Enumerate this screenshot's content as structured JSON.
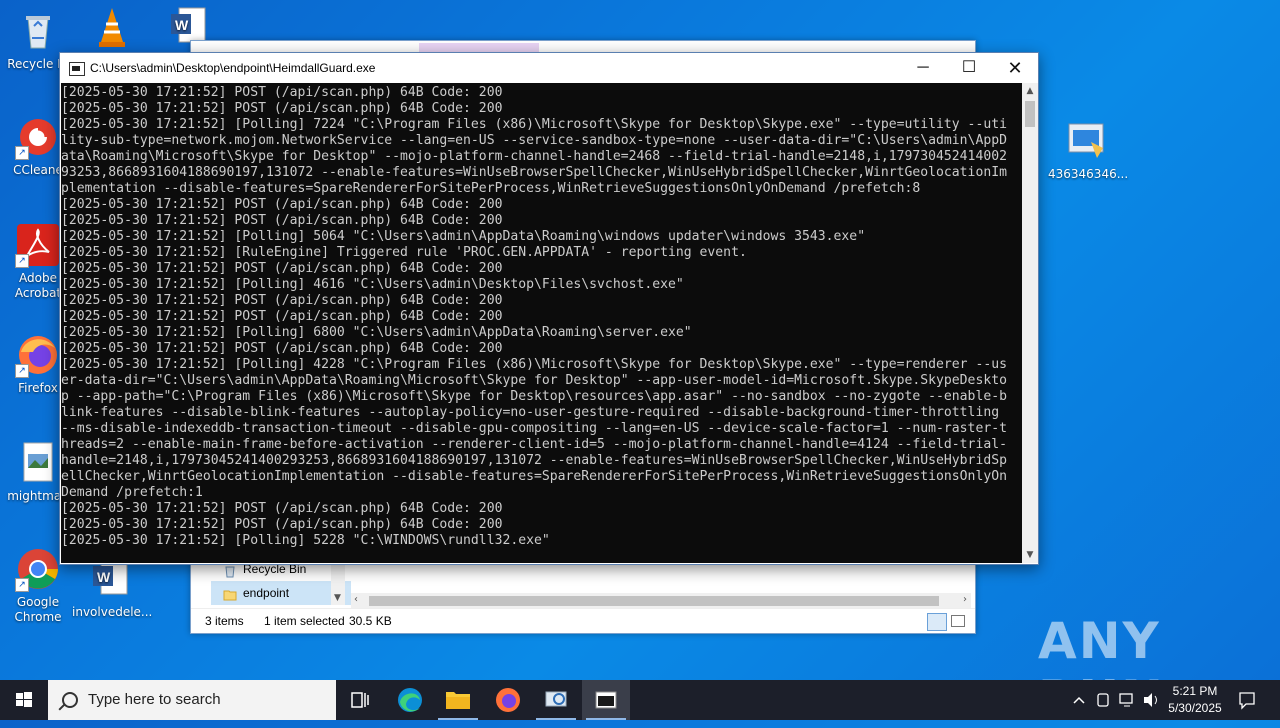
{
  "desktop": {
    "icons": [
      {
        "label": "Recycle Bi"
      },
      {
        "label": "CCleane"
      },
      {
        "label": "Adobe Acrobat"
      },
      {
        "label": "Firefox"
      },
      {
        "label": "mightmad"
      },
      {
        "label": "Google Chrome"
      },
      {
        "label": "involvedele..."
      },
      {
        "label": "436346346..."
      }
    ]
  },
  "explorer": {
    "nav_items": [
      {
        "label": "Recycle Bin"
      },
      {
        "label": "endpoint"
      }
    ],
    "status": {
      "items_count": "3 items",
      "selected": "1 item selected",
      "size": "30.5 KB"
    }
  },
  "console": {
    "title": "C:\\Users\\admin\\Desktop\\endpoint\\HeimdallGuard.exe",
    "lines": [
      "[2025-05-30 17:21:52] POST (/api/scan.php) 64B Code: 200",
      "[2025-05-30 17:21:52] POST (/api/scan.php) 64B Code: 200",
      "[2025-05-30 17:21:52] [Polling] 7224 \"C:\\Program Files (x86)\\Microsoft\\Skype for Desktop\\Skype.exe\" --type=utility --uti",
      "lity-sub-type=network.mojom.NetworkService --lang=en-US --service-sandbox-type=none --user-data-dir=\"C:\\Users\\admin\\AppD",
      "ata\\Roaming\\Microsoft\\Skype for Desktop\" --mojo-platform-channel-handle=2468 --field-trial-handle=2148,i,179730452414002",
      "93253,8668931604188690197,131072 --enable-features=WinUseBrowserSpellChecker,WinUseHybridSpellChecker,WinrtGeolocationIm",
      "plementation --disable-features=SpareRendererForSitePerProcess,WinRetrieveSuggestionsOnlyOnDemand /prefetch:8",
      "[2025-05-30 17:21:52] POST (/api/scan.php) 64B Code: 200",
      "[2025-05-30 17:21:52] POST (/api/scan.php) 64B Code: 200",
      "[2025-05-30 17:21:52] [Polling] 5064 \"C:\\Users\\admin\\AppData\\Roaming\\windows updater\\windows 3543.exe\"",
      "[2025-05-30 17:21:52] [RuleEngine] Triggered rule 'PROC.GEN.APPDATA' - reporting event.",
      "[2025-05-30 17:21:52] POST (/api/scan.php) 64B Code: 200",
      "[2025-05-30 17:21:52] [Polling] 4616 \"C:\\Users\\admin\\Desktop\\Files\\svchost.exe\"",
      "[2025-05-30 17:21:52] POST (/api/scan.php) 64B Code: 200",
      "[2025-05-30 17:21:52] POST (/api/scan.php) 64B Code: 200",
      "[2025-05-30 17:21:52] [Polling] 6800 \"C:\\Users\\admin\\AppData\\Roaming\\server.exe\"",
      "[2025-05-30 17:21:52] POST (/api/scan.php) 64B Code: 200",
      "[2025-05-30 17:21:52] [Polling] 4228 \"C:\\Program Files (x86)\\Microsoft\\Skype for Desktop\\Skype.exe\" --type=renderer --us",
      "er-data-dir=\"C:\\Users\\admin\\AppData\\Roaming\\Microsoft\\Skype for Desktop\" --app-user-model-id=Microsoft.Skype.SkypeDeskto",
      "p --app-path=\"C:\\Program Files (x86)\\Microsoft\\Skype for Desktop\\resources\\app.asar\" --no-sandbox --no-zygote --enable-b",
      "link-features --disable-blink-features --autoplay-policy=no-user-gesture-required --disable-background-timer-throttling",
      "--ms-disable-indexeddb-transaction-timeout --disable-gpu-compositing --lang=en-US --device-scale-factor=1 --num-raster-t",
      "hreads=2 --enable-main-frame-before-activation --renderer-client-id=5 --mojo-platform-channel-handle=4124 --field-trial-",
      "handle=2148,i,17973045241400293253,8668931604188690197,131072 --enable-features=WinUseBrowserSpellChecker,WinUseHybridSp",
      "ellChecker,WinrtGeolocationImplementation --disable-features=SpareRendererForSitePerProcess,WinRetrieveSuggestionsOnlyOn",
      "Demand /prefetch:1",
      "[2025-05-30 17:21:52] POST (/api/scan.php) 64B Code: 200",
      "[2025-05-30 17:21:52] POST (/api/scan.php) 64B Code: 200",
      "[2025-05-30 17:21:52] [Polling] 5228 \"C:\\WINDOWS\\rundll32.exe\""
    ]
  },
  "watermark": "ANY RUN",
  "taskbar": {
    "search_placeholder": "Type here to search",
    "clock_time": "5:21 PM",
    "clock_date": "5/30/2025"
  }
}
